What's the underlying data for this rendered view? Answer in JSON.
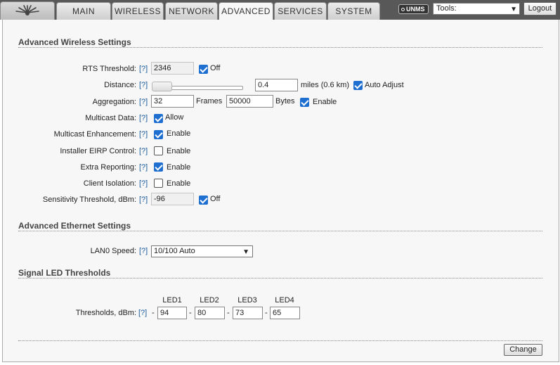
{
  "nav": {
    "tabs": [
      {
        "label": "MAIN"
      },
      {
        "label": "WIRELESS"
      },
      {
        "label": "NETWORK"
      },
      {
        "label": "ADVANCED"
      },
      {
        "label": "SERVICES"
      },
      {
        "label": "SYSTEM"
      }
    ],
    "active_tab": "ADVANCED",
    "unms_label": "UNMS",
    "tools_selected": "Tools:",
    "logout_label": "Logout"
  },
  "help_label": "[?]",
  "wireless": {
    "title": "Advanced Wireless Settings",
    "rts": {
      "label": "RTS Threshold:",
      "value": "2346",
      "off_checked": true,
      "off_label": "Off"
    },
    "distance": {
      "label": "Distance:",
      "slider_position": 0.0,
      "value": "0.4",
      "unit_text": "miles (0.6 km)",
      "auto_checked": true,
      "auto_label": "Auto Adjust"
    },
    "aggregation": {
      "label": "Aggregation:",
      "frames_value": "32",
      "frames_label": "Frames",
      "bytes_value": "50000",
      "bytes_label": "Bytes",
      "enable_checked": true,
      "enable_label": "Enable"
    },
    "multicast_data": {
      "label": "Multicast Data:",
      "checked": true,
      "option_label": "Allow"
    },
    "multicast_enhancement": {
      "label": "Multicast Enhancement:",
      "checked": true,
      "option_label": "Enable"
    },
    "installer_eirp": {
      "label": "Installer EIRP Control:",
      "checked": false,
      "option_label": "Enable"
    },
    "extra_reporting": {
      "label": "Extra Reporting:",
      "checked": true,
      "option_label": "Enable"
    },
    "client_isolation": {
      "label": "Client Isolation:",
      "checked": false,
      "option_label": "Enable"
    },
    "sensitivity": {
      "label": "Sensitivity Threshold, dBm:",
      "value": "-96",
      "off_checked": true,
      "off_label": "Off"
    }
  },
  "ethernet": {
    "title": "Advanced Ethernet Settings",
    "lan0": {
      "label": "LAN0 Speed:",
      "selected": "10/100 Auto"
    }
  },
  "led": {
    "title": "Signal LED Thresholds",
    "thresholds_label": "Thresholds, dBm:",
    "separator": "-",
    "leds": [
      {
        "name": "LED1",
        "value": "94"
      },
      {
        "name": "LED2",
        "value": "80"
      },
      {
        "name": "LED3",
        "value": "73"
      },
      {
        "name": "LED4",
        "value": "65"
      }
    ]
  },
  "change_label": "Change"
}
